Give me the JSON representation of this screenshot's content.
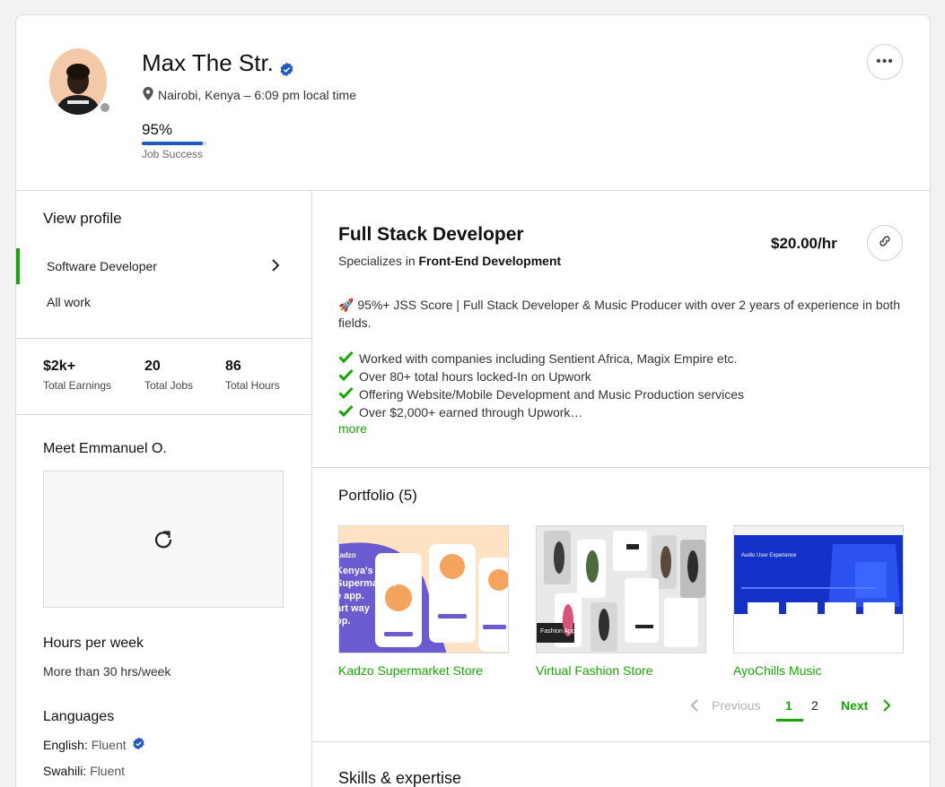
{
  "profile": {
    "name": "Max The Str.",
    "location": "Nairobi, Kenya – 6:09 pm local time",
    "job_success_value": "95%",
    "job_success_fraction": 0.95,
    "job_success_label": "Job Success"
  },
  "sidebar": {
    "view_profile_title": "View profile",
    "items": [
      {
        "label": "Software Developer",
        "active": true
      },
      {
        "label": "All work",
        "active": false
      }
    ],
    "stats": [
      {
        "value": "$2k+",
        "label": "Total Earnings"
      },
      {
        "value": "20",
        "label": "Total Jobs"
      },
      {
        "value": "86",
        "label": "Total Hours"
      }
    ],
    "meet_title": "Meet Emmanuel O.",
    "hours_per_week_title": "Hours per week",
    "hours_per_week_value": "More than 30 hrs/week",
    "languages_title": "Languages",
    "languages": [
      {
        "name": "English:",
        "level": "Fluent",
        "verified": true
      },
      {
        "name": "Swahili:",
        "level": "Fluent",
        "verified": false
      }
    ]
  },
  "main": {
    "title": "Full Stack Developer",
    "specializes_prefix": "Specializes in",
    "specializes_value": "Front-End Development",
    "rate": "$20.00/hr",
    "overview_intro": "🚀 95%+ JSS Score | Full Stack Developer & Music Producer with over 2 years of experience in both fields.",
    "checklist": [
      "Worked with companies including Sentient Africa, Magix Empire etc.",
      "Over 80+ total hours locked-In on Upwork",
      "Offering Website/Mobile Development and Music Production services",
      "Over $2,000+ earned through Upwork…"
    ],
    "more_label": "more",
    "portfolio_title": "Portfolio (5)",
    "portfolio": [
      {
        "name": "Kadzo Supermarket Store",
        "thumb_text": [
          "kadzo",
          "Kenya's",
          "Supermarket",
          "e app.",
          "art way",
          "op."
        ]
      },
      {
        "name": "Virtual Fashion Store",
        "thumb_text": [
          "Fashion App"
        ]
      },
      {
        "name": "AyoChills Music",
        "thumb_text": [
          "Audio User Experience"
        ]
      }
    ],
    "pagination": {
      "previous": "Previous",
      "pages": [
        "1",
        "2"
      ],
      "current": "1",
      "next": "Next"
    },
    "skills_title": "Skills & expertise"
  },
  "colors": {
    "accent_green": "#14a800",
    "verified_blue": "#1f57c3",
    "presence_gray": "#9e9e9e"
  }
}
